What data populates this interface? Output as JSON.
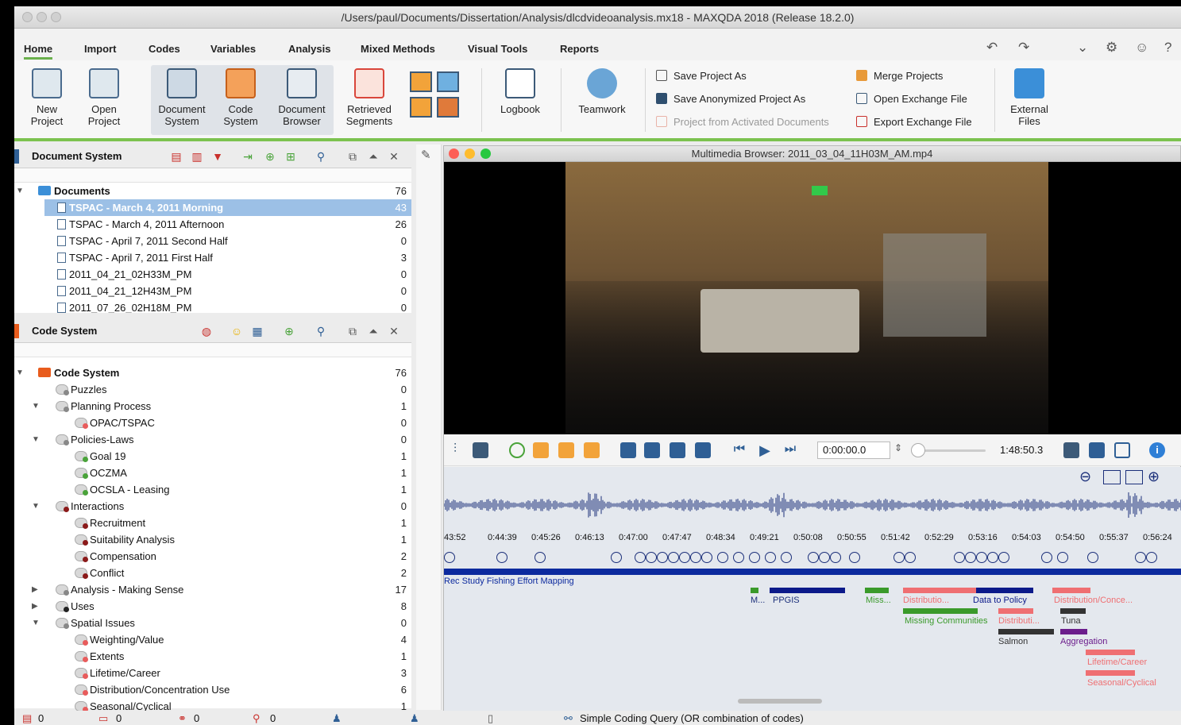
{
  "window": {
    "title": "/Users/paul/Documents/Dissertation/Analysis/dlcdvideoanalysis.mx18 - MAXQDA 2018 (Release 18.2.0)"
  },
  "menu": [
    "Home",
    "Import",
    "Codes",
    "Variables",
    "Analysis",
    "Mixed Methods",
    "Visual Tools",
    "Reports"
  ],
  "ribbon": {
    "new_project": "New Project",
    "open_project": "Open Project",
    "document_system": "Document System",
    "code_system": "Code System",
    "document_browser": "Document Browser",
    "retrieved_segments": "Retrieved Segments",
    "logbook": "Logbook",
    "teamwork": "Teamwork",
    "save_project_as": "Save Project As",
    "save_anonymized": "Save Anonymized Project As",
    "project_from_activated": "Project from Activated Documents",
    "merge_projects": "Merge Projects",
    "open_exchange": "Open Exchange File",
    "export_exchange": "Export Exchange File",
    "external_files": "External Files"
  },
  "document_system": {
    "title": "Document System",
    "root": {
      "label": "Documents",
      "count": "76"
    },
    "items": [
      {
        "label": "TSPAC - March 4, 2011 Morning",
        "count": "43"
      },
      {
        "label": "TSPAC - March 4, 2011 Afternoon",
        "count": "26"
      },
      {
        "label": "TSPAC - April 7, 2011 Second Half",
        "count": "0"
      },
      {
        "label": "TSPAC - April 7, 2011 First Half",
        "count": "3"
      },
      {
        "label": "2011_04_21_02H33M_PM",
        "count": "0"
      },
      {
        "label": "2011_04_21_12H43M_PM",
        "count": "0"
      },
      {
        "label": "2011_07_26_02H18M_PM",
        "count": "0"
      }
    ]
  },
  "code_system": {
    "title": "Code System",
    "root": {
      "label": "Code System",
      "count": "76"
    },
    "items": [
      {
        "label": "Puzzles",
        "count": "0",
        "level": 1,
        "dot": "#888"
      },
      {
        "label": "Planning Process",
        "count": "1",
        "level": 1,
        "dot": "#888"
      },
      {
        "label": "OPAC/TSPAC",
        "count": "0",
        "level": 2,
        "dot": "#e85c5c"
      },
      {
        "label": "Policies-Laws",
        "count": "0",
        "level": 1,
        "dot": "#888"
      },
      {
        "label": "Goal 19",
        "count": "1",
        "level": 2,
        "dot": "#4aa33a"
      },
      {
        "label": "OCZMA",
        "count": "1",
        "level": 2,
        "dot": "#4aa33a"
      },
      {
        "label": "OCSLA - Leasing",
        "count": "1",
        "level": 2,
        "dot": "#4aa33a"
      },
      {
        "label": "Interactions",
        "count": "0",
        "level": 1,
        "dot": "#8b1a1a"
      },
      {
        "label": "Recruitment",
        "count": "1",
        "level": 2,
        "dot": "#8b1a1a"
      },
      {
        "label": "Suitability Analysis",
        "count": "1",
        "level": 2,
        "dot": "#8b1a1a"
      },
      {
        "label": "Compensation",
        "count": "2",
        "level": 2,
        "dot": "#8b1a1a"
      },
      {
        "label": "Conflict",
        "count": "2",
        "level": 2,
        "dot": "#8b1a1a"
      },
      {
        "label": "Analysis - Making Sense",
        "count": "17",
        "level": 1,
        "dot": "#888"
      },
      {
        "label": "Uses",
        "count": "8",
        "level": 1,
        "dot": "#222"
      },
      {
        "label": "Spatial Issues",
        "count": "0",
        "level": 1,
        "dot": "#888"
      },
      {
        "label": "Weighting/Value",
        "count": "4",
        "level": 2,
        "dot": "#e85c5c"
      },
      {
        "label": "Extents",
        "count": "1",
        "level": 2,
        "dot": "#e85c5c"
      },
      {
        "label": "Lifetime/Career",
        "count": "3",
        "level": 2,
        "dot": "#e85c5c"
      },
      {
        "label": "Distribution/Concentration Use",
        "count": "6",
        "level": 2,
        "dot": "#e85c5c"
      },
      {
        "label": "Seasonal/Cyclical",
        "count": "1",
        "level": 2,
        "dot": "#e85c5c"
      }
    ]
  },
  "media": {
    "title": "Multimedia Browser:  2011_03_04_11H03M_AM.mp4",
    "position": "0:00:00.0",
    "duration": "1:48:50.3",
    "ticks": [
      "43:52",
      "0:44:39",
      "0:45:26",
      "0:46:13",
      "0:47:00",
      "0:47:47",
      "0:48:34",
      "0:49:21",
      "0:50:08",
      "0:50:55",
      "0:51:42",
      "0:52:29",
      "0:53:16",
      "0:54:03",
      "0:54:50",
      "0:55:37",
      "0:56:24"
    ],
    "lane_label": "Rec Study Fishing Effort Mapping",
    "segment_labels": {
      "m": "M...",
      "ppgis": "PPGIS",
      "miss": "Miss...",
      "distributio": "Distributio...",
      "data_to_policy": "Data to Policy",
      "distribution_conce": "Distribution/Conce...",
      "missing_communities": "Missing Communities",
      "distributi": "Distributi...",
      "tuna": "Tuna",
      "salmon": "Salmon",
      "aggregation": "Aggregation",
      "lifetime": "Lifetime/Career",
      "seasonal": "Seasonal/Cyclical"
    }
  },
  "status": {
    "docs": "0",
    "codes": "0",
    "memos": "0",
    "vars": "0",
    "query": "Simple Coding Query (OR combination of codes)"
  }
}
